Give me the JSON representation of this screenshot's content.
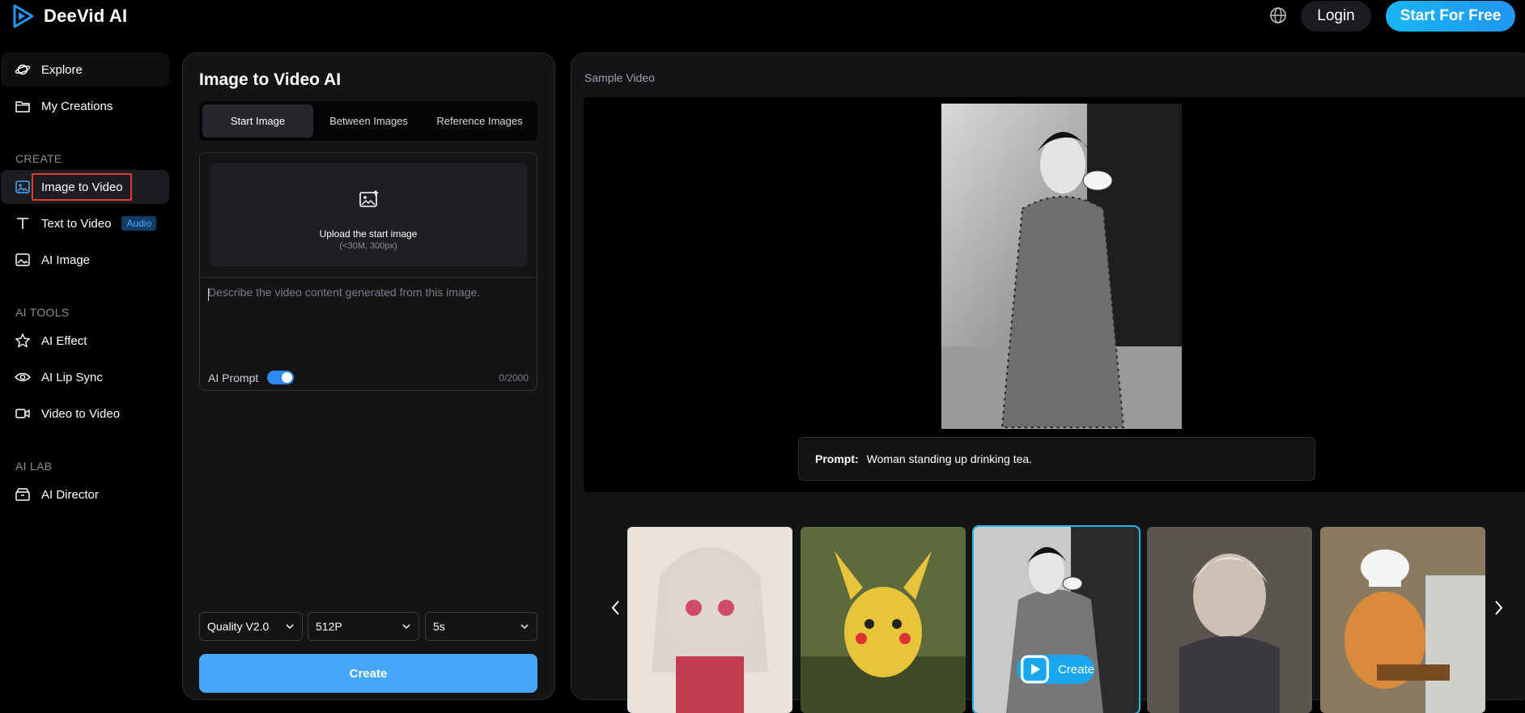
{
  "app": {
    "name": "DeeVid AI"
  },
  "header": {
    "login_label": "Login",
    "start_label": "Start For Free"
  },
  "sidebar": {
    "top_items": [
      {
        "label": "Explore",
        "icon": "planet-icon"
      },
      {
        "label": "My Creations",
        "icon": "folder-icon"
      }
    ],
    "sections": [
      {
        "label": "CREATE"
      },
      {
        "label": "AI TOOLS"
      },
      {
        "label": "AI LAB"
      }
    ],
    "create_items": [
      {
        "label": "Image to Video",
        "icon": "image-icon"
      },
      {
        "label": "Text to Video",
        "icon": "text-icon",
        "badge": "Audio"
      },
      {
        "label": "AI Image",
        "icon": "picture-icon"
      }
    ],
    "tool_items": [
      {
        "label": "AI Effect",
        "icon": "star-icon"
      },
      {
        "label": "AI Lip Sync",
        "icon": "eye-icon"
      },
      {
        "label": "Video to Video",
        "icon": "video-camera-icon"
      }
    ],
    "lab_items": [
      {
        "label": "AI Director",
        "icon": "director-icon"
      }
    ]
  },
  "panel": {
    "title": "Image to Video AI",
    "tabs": [
      "Start Image",
      "Between Images",
      "Reference Images"
    ],
    "active_tab": "Start Image",
    "upload": {
      "title": "Upload the start image",
      "sub": "(<30M, 300px)"
    },
    "prompt_placeholder": "Describe the video content generated from this image.",
    "ai_prompt_label": "AI Prompt",
    "ai_prompt_enabled": true,
    "counter": "0/2000",
    "selects": {
      "quality": "Quality V2.0",
      "resolution": "512P",
      "duration": "5s"
    },
    "create_label": "Create"
  },
  "sample": {
    "label": "Sample Video",
    "prompt_key": "Prompt:",
    "prompt_text": "Woman standing up drinking tea.",
    "thumb_create_label": "Create",
    "active_thumb": 2
  },
  "colors": {
    "accent": "#2d8cf0",
    "start_gradient_a": "#17b5f5",
    "start_gradient_b": "#2196f3",
    "highlight": "#e53935"
  }
}
